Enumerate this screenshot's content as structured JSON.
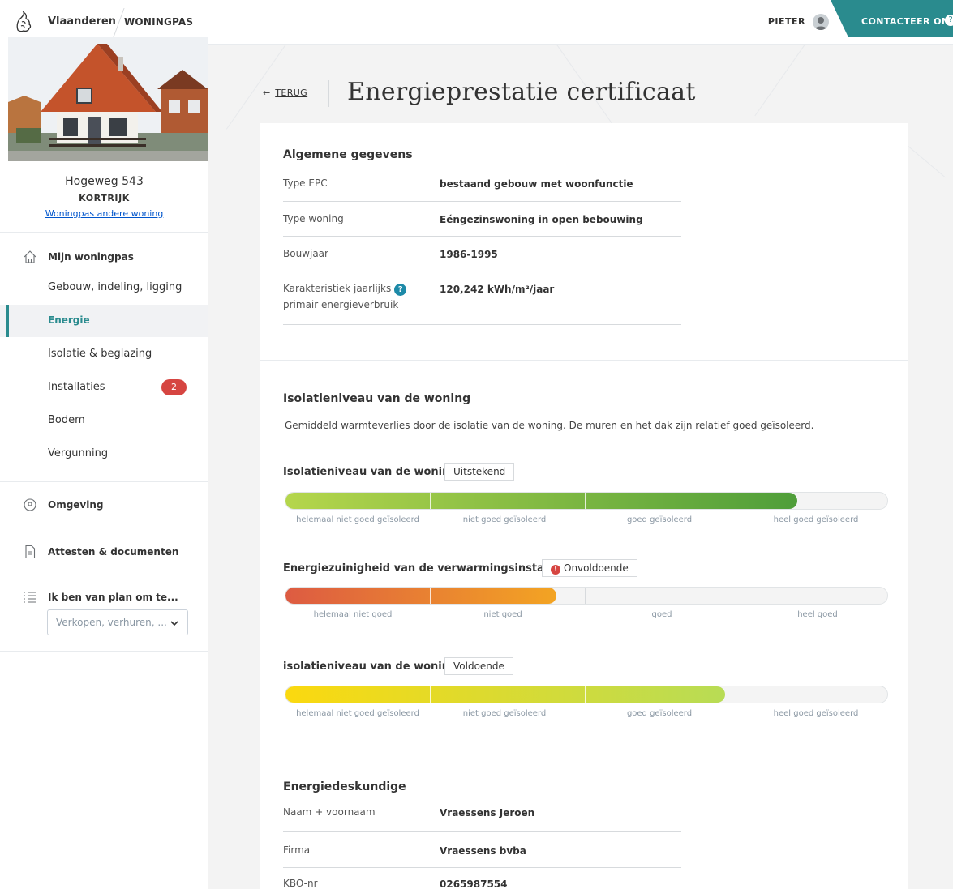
{
  "header": {
    "brand": "Vlaanderen",
    "product": "WONINGPAS",
    "user": "PIETER",
    "contact_label": "CONTACTEER ONS"
  },
  "sidebar": {
    "address": "Hogeweg 543",
    "city": "KORTRIJK",
    "other_link": "Woningpas andere woning",
    "section_mine": "Mijn woningpas",
    "items": [
      {
        "label": "Gebouw, indeling, ligging"
      },
      {
        "label": "Energie",
        "active": true
      },
      {
        "label": "Isolatie & beglazing"
      },
      {
        "label": "Installaties",
        "badge": "2"
      },
      {
        "label": "Bodem"
      },
      {
        "label": "Vergunning"
      }
    ],
    "section_omgeving": "Omgeving",
    "section_attesten": "Attesten & documenten",
    "section_plan": "Ik ben van plan om te...",
    "plan_select": "Verkopen, verhuren, ..."
  },
  "main": {
    "back_label": "TERUG",
    "title": "Energieprestatie certificaat",
    "general": {
      "title": "Algemene gegevens",
      "rows": [
        {
          "label": "Type EPC",
          "value": "bestaand gebouw met woonfunctie"
        },
        {
          "label": "Type woning",
          "value": "Eéngezinswoning in open bebouwing"
        },
        {
          "label": "Bouwjaar",
          "value": "1986-1995"
        },
        {
          "label": "Karakteristiek jaarlijks",
          "label2": "primair energieverbruik",
          "value": "120,242 kWh/m²/jaar"
        }
      ]
    },
    "insulation": {
      "title": "Isolatieniveau van de woning",
      "description": "Gemiddeld warmteverlies door de isolatie van de woning. De muren en het dak zijn relatief goed geïsoleerd.",
      "meters": [
        {
          "title": "Isolatieniveau van de woning",
          "tag": "Uitstekend",
          "warning": false,
          "fill_percent": 85,
          "colors": [
            "#b5d64c",
            "#4f9e3a"
          ],
          "scale": [
            "helemaal niet goed geïsoleerd",
            "niet goed geïsoleerd",
            "goed geïsoleerd",
            "heel goed geïsoleerd"
          ]
        },
        {
          "title": "Energiezuinigheid van de verwarmingsinstallatie",
          "tag": "Onvoldoende",
          "warning": true,
          "fill_percent": 45,
          "colors": [
            "#dd5b42",
            "#f3a423"
          ],
          "scale": [
            "helemaal niet goed",
            "niet goed",
            "goed",
            "heel goed"
          ]
        },
        {
          "title": "isolatieniveau van de woning",
          "tag": "Voldoende",
          "warning": false,
          "fill_percent": 73,
          "colors": [
            "#fbd90f",
            "#b8dc55"
          ],
          "scale": [
            "helemaal niet goed geïsoleerd",
            "niet goed geïsoleerd",
            "goed geïsoleerd",
            "heel goed geïsoleerd"
          ]
        }
      ]
    },
    "expert": {
      "title": "Energiedeskundige",
      "rows": [
        {
          "label": "Naam + voornaam",
          "value": "Vraessens Jeroen"
        },
        {
          "label": "Firma",
          "value": "Vraessens bvba"
        },
        {
          "label": "KBO-nr",
          "value": "0265987554"
        }
      ]
    }
  }
}
